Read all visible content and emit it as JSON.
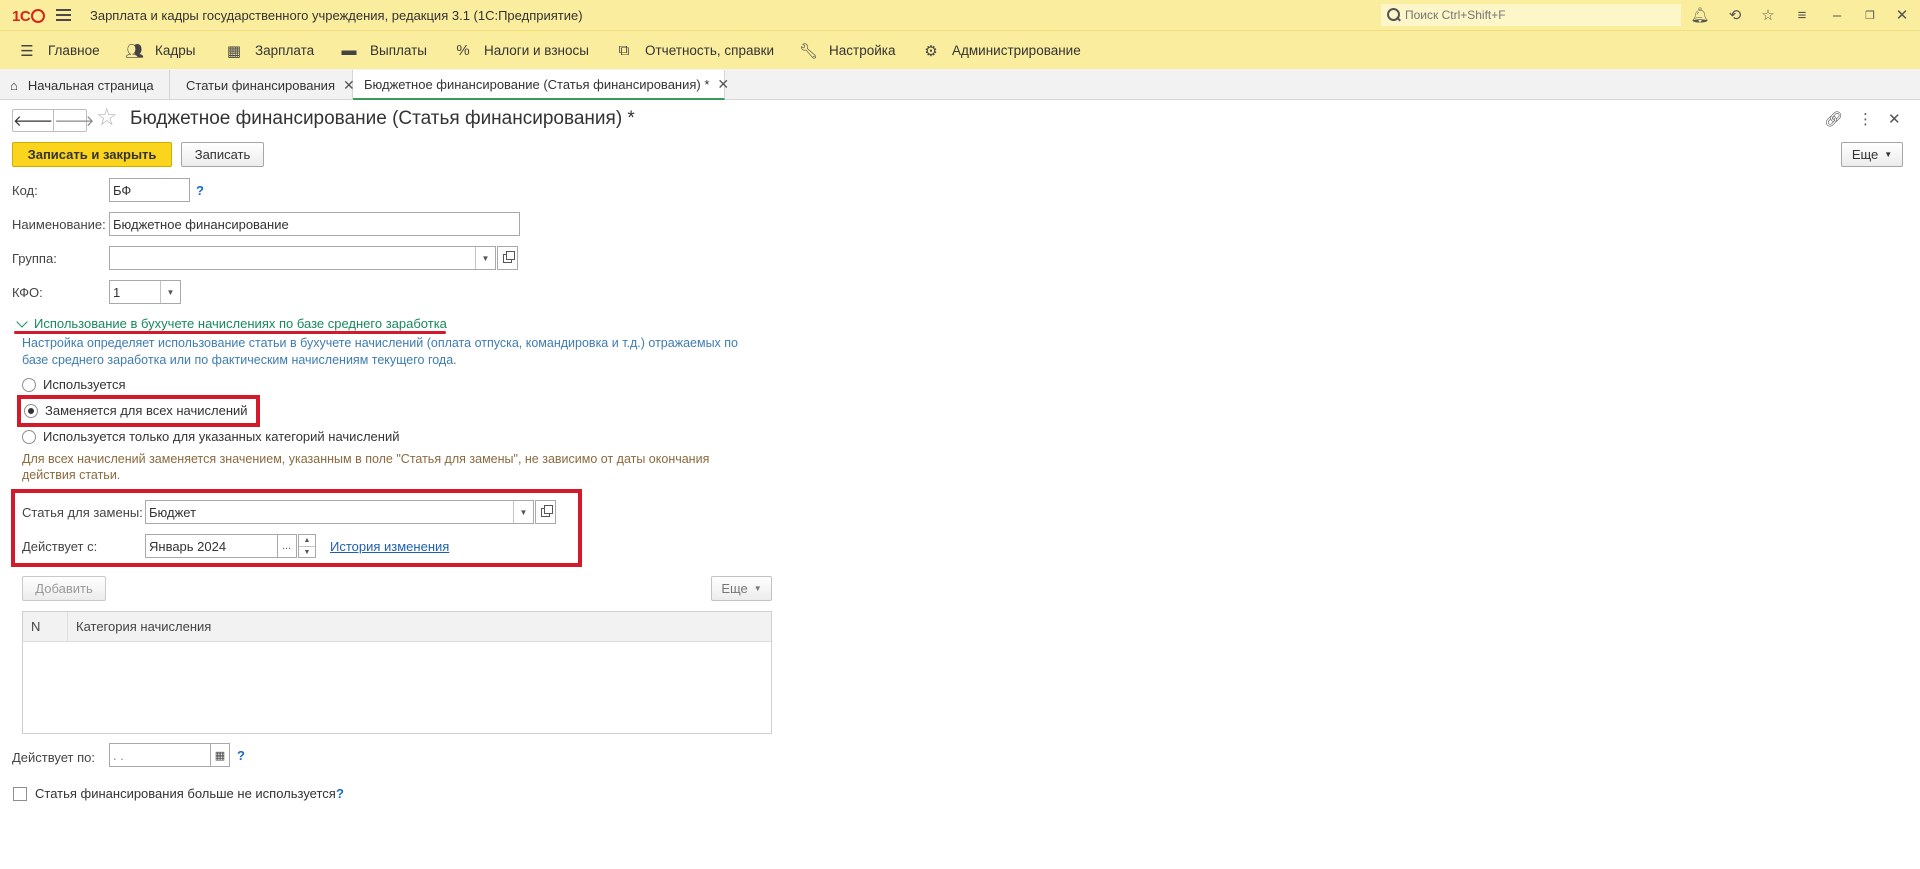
{
  "titlebar": {
    "logo": "1С",
    "title": "Зарплата и кадры государственного учреждения, редакция 3.1  (1С:Предприятие)",
    "search_placeholder": "Поиск Ctrl+Shift+F"
  },
  "sections": [
    {
      "label": "Главное",
      "icon": "menu-icon"
    },
    {
      "label": "Кадры",
      "icon": "people-icon"
    },
    {
      "label": "Зарплата",
      "icon": "calculator-icon"
    },
    {
      "label": "Выплаты",
      "icon": "wallet-icon"
    },
    {
      "label": "Налоги и взносы",
      "icon": "percent-icon"
    },
    {
      "label": "Отчетность, справки",
      "icon": "reports-icon"
    },
    {
      "label": "Настройка",
      "icon": "wrench-icon"
    },
    {
      "label": "Администрирование",
      "icon": "gear-icon"
    }
  ],
  "tabs": [
    {
      "label": "Начальная страница"
    },
    {
      "label": "Статьи финансирования"
    },
    {
      "label": "Бюджетное финансирование (Статья финансирования) *"
    }
  ],
  "form": {
    "title": "Бюджетное финансирование (Статья финансирования) *",
    "save_close_label": "Записать и закрыть",
    "save_label": "Записать",
    "more_label": "Еще",
    "code_label": "Код:",
    "code_value": "БФ",
    "name_label": "Наименование:",
    "name_value": "Бюджетное финансирование",
    "group_label": "Группа:",
    "group_value": "",
    "kfo_label": "КФО:",
    "kfo_value": "1",
    "help_mark": "?"
  },
  "usage_group": {
    "header": "Использование в бухучете начислениях по базе среднего заработка",
    "description_line1": "Настройка определяет использование статьи в бухучете начислений (оплата отпуска, командировка и т.д.) отражаемых по",
    "description_line2": "базе среднего заработка или по фактическим начислениям текущего года.",
    "options": [
      {
        "label": "Используется",
        "selected": false
      },
      {
        "label": "Заменяется для всех начислений",
        "selected": true
      },
      {
        "label": "Используется только для указанных категорий начислений",
        "selected": false
      }
    ],
    "hint_line1": "Для всех начислений заменяется значением, указанным в поле \"Статья для замены\", не зависимо от даты окончания",
    "hint_line2": "действия статьи.",
    "replace_label": "Статья для замены:",
    "replace_value": "Бюджет",
    "valid_from_label": "Действует с:",
    "valid_from_value": "Январь 2024",
    "history_link": "История изменения"
  },
  "table": {
    "add_label": "Добавить",
    "more_label": "Еще",
    "columns": [
      "N",
      "Категория начисления"
    ],
    "rows": []
  },
  "footer": {
    "valid_to_label": "Действует по:",
    "valid_to_value": "  .  .",
    "not_used_label": "Статья финансирования больше не используется"
  },
  "colors": {
    "header_bg": "#fbed9e",
    "primary_button": "#fad41d",
    "group_header": "#17895a",
    "highlight": "#d21a2a",
    "link": "#1d5fb5"
  }
}
